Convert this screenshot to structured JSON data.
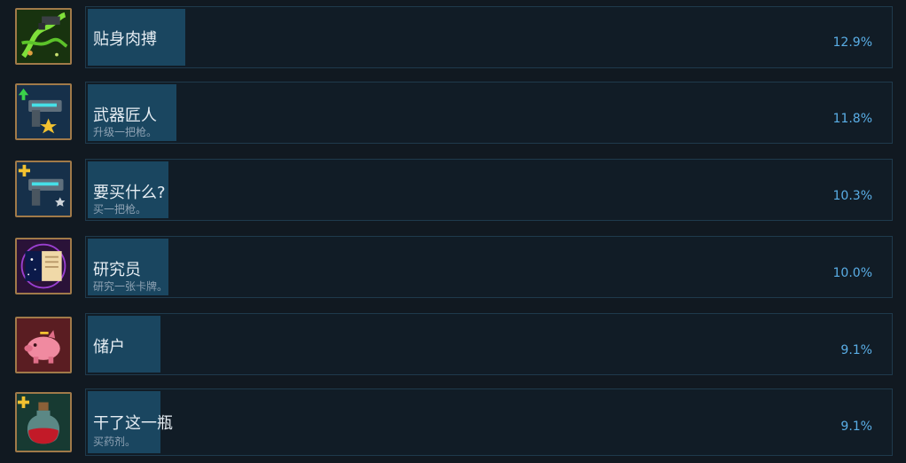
{
  "colors": {
    "background": "#111921",
    "progress_fill": "#1a4660",
    "percent_text": "#5aaee6",
    "icon_border": "#a17a49"
  },
  "achievements": [
    {
      "title": "贴身肉搏",
      "description": "",
      "percent": "12.9%",
      "percent_value": 12.9,
      "icon": "green-tentacle-weapon-icon"
    },
    {
      "title": "武器匠人",
      "description": "升级一把枪。",
      "percent": "11.8%",
      "percent_value": 11.8,
      "icon": "gun-upgrade-star-icon"
    },
    {
      "title": "要买什么?",
      "description": "买一把枪。",
      "percent": "10.3%",
      "percent_value": 10.3,
      "icon": "gun-buy-plus-icon"
    },
    {
      "title": "研究员",
      "description": "研究一张卡牌。",
      "percent": "10.0%",
      "percent_value": 10.0,
      "icon": "open-book-icon"
    },
    {
      "title": "储户",
      "description": "",
      "percent": "9.1%",
      "percent_value": 9.1,
      "icon": "piggy-bank-icon"
    },
    {
      "title": "干了这一瓶",
      "description": "买药剂。",
      "percent": "9.1%",
      "percent_value": 9.1,
      "icon": "red-potion-bottle-icon"
    }
  ]
}
